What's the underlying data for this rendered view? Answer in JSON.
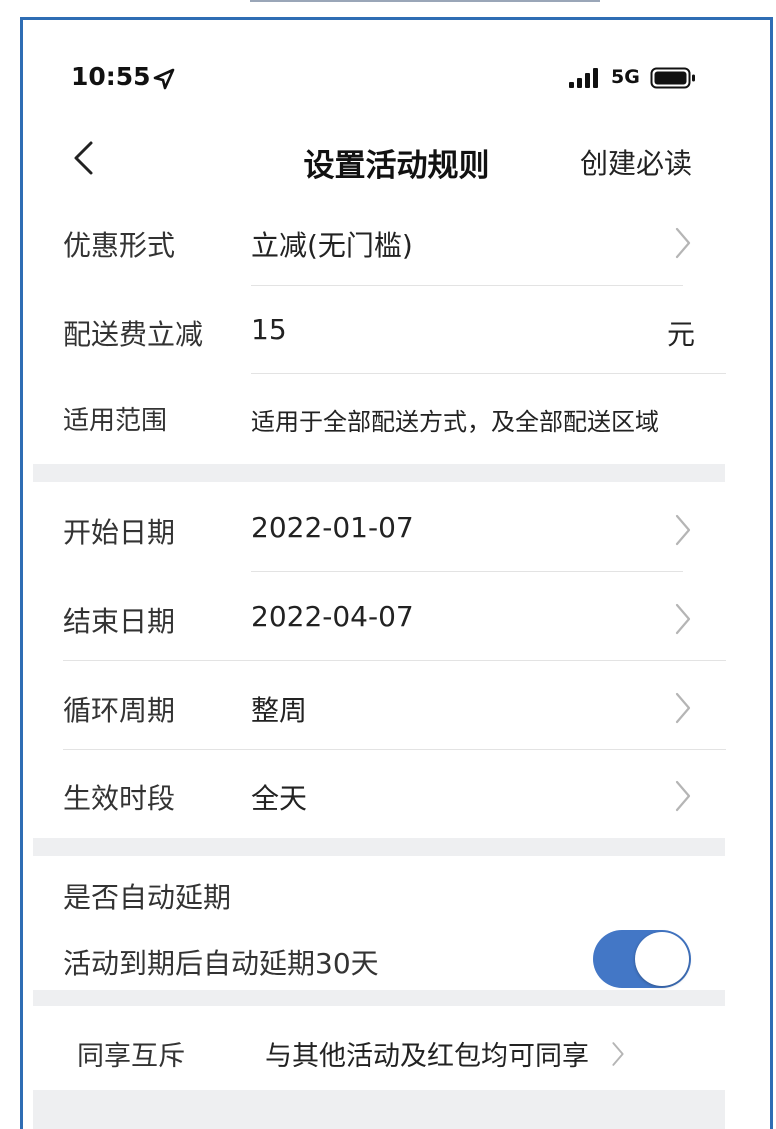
{
  "status_bar": {
    "time": "10:55",
    "network": "5G"
  },
  "nav": {
    "title": "设置活动规则",
    "right_link": "创建必读"
  },
  "discount_form": {
    "label": "优惠形式",
    "value": "立减(无门槛)"
  },
  "delivery_fee": {
    "label": "配送费立减",
    "value": "15",
    "unit": "元"
  },
  "scope": {
    "label": "适用范围",
    "value": "适用于全部配送方式，及全部配送区域"
  },
  "start_date": {
    "label": "开始日期",
    "value": "2022-01-07"
  },
  "end_date": {
    "label": "结束日期",
    "value": "2022-04-07"
  },
  "cycle": {
    "label": "循环周期",
    "value": "整周"
  },
  "time_period": {
    "label": "生效时段",
    "value": "全天"
  },
  "auto_extend": {
    "heading": "是否自动延期",
    "description": "活动到期后自动延期30天",
    "enabled": true
  },
  "share": {
    "label": "同享互斥",
    "value": "与其他活动及红包均可同享"
  },
  "colors": {
    "accent": "#4377c6",
    "frame": "#2f6db4",
    "section_gap": "#eeeff1"
  }
}
